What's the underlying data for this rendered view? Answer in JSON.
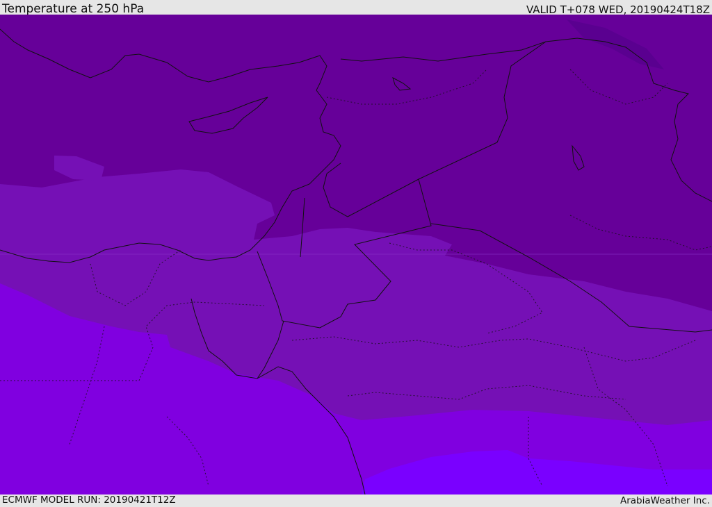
{
  "header": {
    "title": "Temperature at 250 hPa",
    "valid": "VALID T+078 WED, 20190424T18Z"
  },
  "footer": {
    "model_run": "ECMWF MODEL RUN: 20190421T12Z",
    "credit": "ArabiaWeather Inc."
  },
  "map": {
    "colors": {
      "deep_purple": "#5a0090",
      "dark_purple": "#660099",
      "purple": "#7510b5",
      "violet": "#8000e0",
      "bright_violet": "#7a00ff",
      "coast": "#111111"
    }
  }
}
